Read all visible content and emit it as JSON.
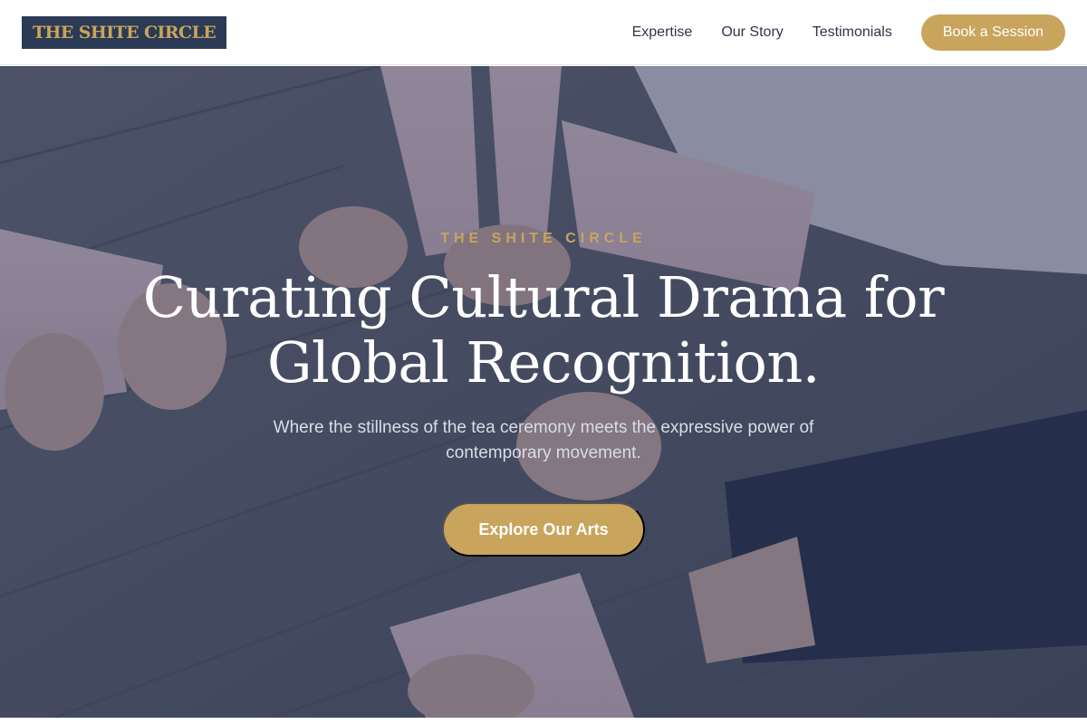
{
  "header": {
    "logo_text": "THE SHITE CIRCLE",
    "nav": [
      {
        "label": "Expertise"
      },
      {
        "label": "Our Story"
      },
      {
        "label": "Testimonials"
      }
    ],
    "cta_label": "Book a Session"
  },
  "hero": {
    "eyebrow": "THE SHITE CIRCLE",
    "headline": "Curating Cultural Drama for Global Recognition.",
    "subtext": "Where the stillness of the tea ceremony meets the expressive power of contemporary movement.",
    "cta_label": "Explore Our Arts",
    "background_image": "dancers' feet in ballet slippers on a wooden floor"
  },
  "colors": {
    "accent_gold": "#c9a45c",
    "brand_navy": "#2b3a55",
    "nav_text": "#2d3748"
  }
}
